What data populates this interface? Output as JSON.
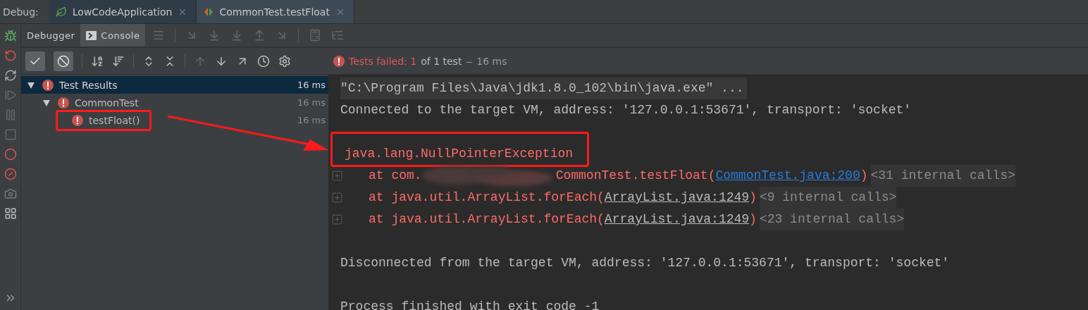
{
  "debug_bar": {
    "label": "Debug:",
    "tabs": [
      {
        "label": "LowCodeApplication",
        "kind": "app",
        "selected": false
      },
      {
        "label": "CommonTest.testFloat",
        "kind": "test",
        "selected": true
      }
    ]
  },
  "sub_tabs": [
    {
      "label": "Debugger",
      "kind": "debugger",
      "selected": false
    },
    {
      "label": "Console",
      "kind": "console",
      "selected": true
    }
  ],
  "test_toolbar": {
    "toggles": [
      {
        "kind": "passed",
        "on": true
      },
      {
        "kind": "ignored",
        "on": true
      }
    ]
  },
  "status": {
    "summary": "Tests failed: 1",
    "detail": "of 1 test",
    "separator": "‒",
    "duration": "16 ms"
  },
  "tree": [
    {
      "label": "Test Results",
      "time": "16 ms",
      "failed": true,
      "expanded": true,
      "selected": true,
      "children": [
        {
          "label": "CommonTest",
          "time": "16 ms",
          "failed": true,
          "expanded": true,
          "selected": false,
          "children": [
            {
              "label": "testFloat()",
              "time": "16 ms",
              "failed": true,
              "selected": false,
              "highlighted": true
            }
          ]
        }
      ]
    }
  ],
  "console": [
    {
      "kind": "command",
      "text": "\"C:\\Program Files\\Java\\jdk1.8.0_102\\bin\\java.exe\" ..."
    },
    {
      "kind": "plain",
      "text": "Connected to the target VM, address: '127.0.0.1:53671', transport: 'socket'"
    },
    {
      "kind": "blank"
    },
    {
      "kind": "error",
      "text": "java.lang.NullPointerException",
      "highlighted": true
    },
    {
      "kind": "stack",
      "text": "at com.",
      "redacted": true,
      "after": "CommonTest.testFloat(",
      "link": "CommonTest.java:200",
      "in_project": true,
      "close": ")",
      "folded": "<31 internal calls>"
    },
    {
      "kind": "stack",
      "text": "at java.util.ArrayList.forEach(",
      "redacted": false,
      "link": "ArrayList.java:1249",
      "in_project": false,
      "close": ")",
      "folded": "<9 internal calls>"
    },
    {
      "kind": "stack",
      "text": "at java.util.ArrayList.forEach(",
      "redacted": false,
      "link": "ArrayList.java:1249",
      "in_project": false,
      "close": ")",
      "folded": "<23 internal calls>"
    },
    {
      "kind": "blank"
    },
    {
      "kind": "plain",
      "text": "Disconnected from the target VM, address: '127.0.0.1:53671', transport: 'socket'"
    },
    {
      "kind": "blank"
    },
    {
      "kind": "plain",
      "text": "Process finished with exit code -1"
    }
  ],
  "arrow": true
}
